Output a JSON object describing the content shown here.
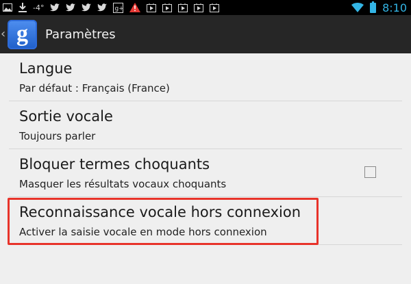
{
  "status_bar": {
    "temperature": "-4°",
    "time": "8:10",
    "icons": [
      "picture-icon",
      "download-icon",
      "twitter-icon",
      "twitter-icon",
      "twitter-icon",
      "twitter-icon",
      "google-plus-icon",
      "warning-icon",
      "play-store-icon",
      "play-store-icon",
      "play-store-icon",
      "play-store-icon",
      "play-store-icon",
      "wifi-icon",
      "battery-icon"
    ]
  },
  "action_bar": {
    "app_icon_letter": "g",
    "title": "Paramètres"
  },
  "settings": [
    {
      "title": "Langue",
      "summary": "Par défaut : Français (France)"
    },
    {
      "title": "Sortie vocale",
      "summary": "Toujours parler"
    },
    {
      "title": "Bloquer termes choquants",
      "summary": "Masquer les résultats vocaux choquants",
      "checked": false
    },
    {
      "title": "Reconnaissance vocale hors connexion",
      "summary": "Activer la saisie vocale en mode hors connexion"
    }
  ],
  "colors": {
    "highlight": "#e8332a",
    "accent": "#33b5e5",
    "background": "#efefef",
    "action_bar": "#262626"
  }
}
